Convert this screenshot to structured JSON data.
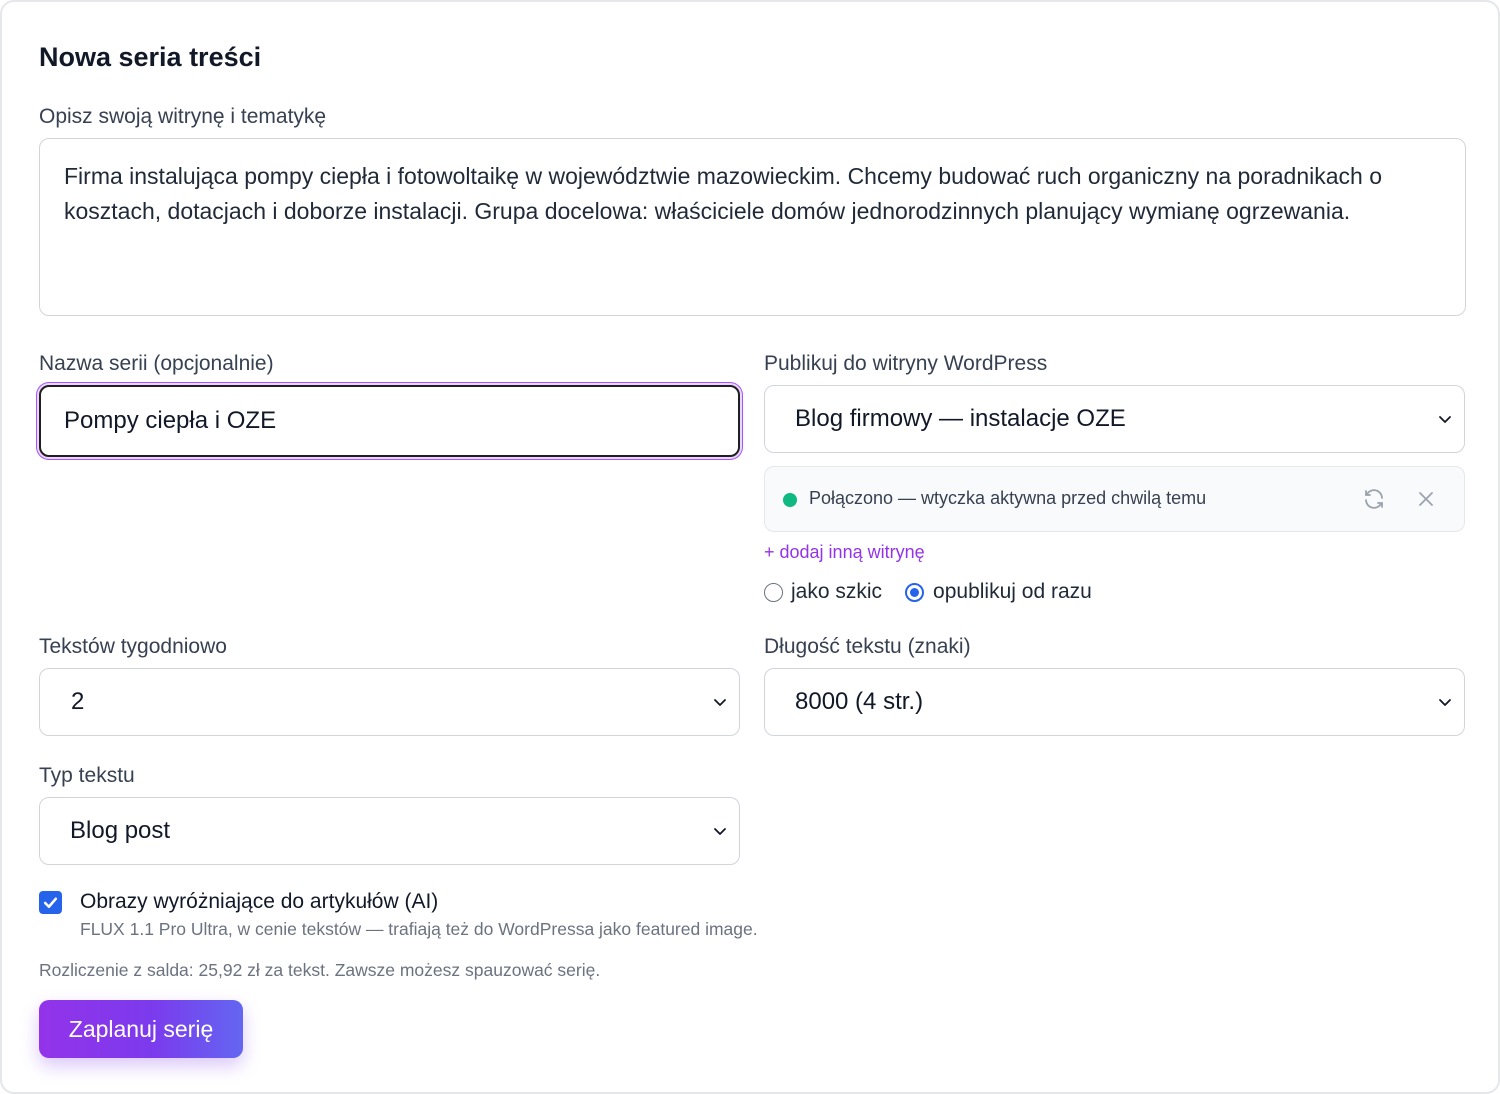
{
  "form": {
    "title": "Nowa seria treści",
    "description": {
      "label": "Opisz swoją witrynę i tematykę",
      "value": "Firma instalująca pompy ciepła i fotowoltaikę w województwie mazowieckim. Chcemy budować ruch organiczny na poradnikach o kosztach, dotacjach i doborze instalacji. Grupa docelowa: właściciele domów jednorodzinnych planujący wymianę ogrzewania."
    },
    "series_name": {
      "label": "Nazwa serii (opcjonalnie)",
      "value": "Pompy ciepła i OZE"
    },
    "wordpress": {
      "label": "Publikuj do witryny WordPress",
      "selected": "Blog firmowy — instalacje OZE",
      "status_text": "Połączono — wtyczka aktywna przed chwilą temu",
      "status_color": "#10b981",
      "refresh_icon": "refresh-icon",
      "close_icon": "close-icon",
      "add_site": "+ dodaj inną witrynę",
      "publish_modes": [
        {
          "label": "jako szkic",
          "checked": false
        },
        {
          "label": "opublikuj od razu",
          "checked": true
        }
      ]
    },
    "weekly": {
      "label": "Tekstów tygodniowo",
      "selected": "2"
    },
    "length": {
      "label": "Długość tekstu (znaki)",
      "selected": "8000 (4 str.)"
    },
    "text_type": {
      "label": "Typ tekstu",
      "selected": "Blog post"
    },
    "images": {
      "checked": true,
      "label": "Obrazy wyróżniające do artykułów (AI)",
      "help": "FLUX 1.1 Pro Ultra, w cenie tekstów — trafiają też do WordPressa jako featured image."
    },
    "billing_note": "Rozliczenie z salda: 25,92 zł za tekst. Zawsze możesz spauzować serię.",
    "submit_label": "Zaplanuj serię",
    "colors": {
      "accent": "#9333ea",
      "checkbox": "#2563eb",
      "button_gradient_start": "#9333ea",
      "button_gradient_end": "#6366f1"
    }
  }
}
